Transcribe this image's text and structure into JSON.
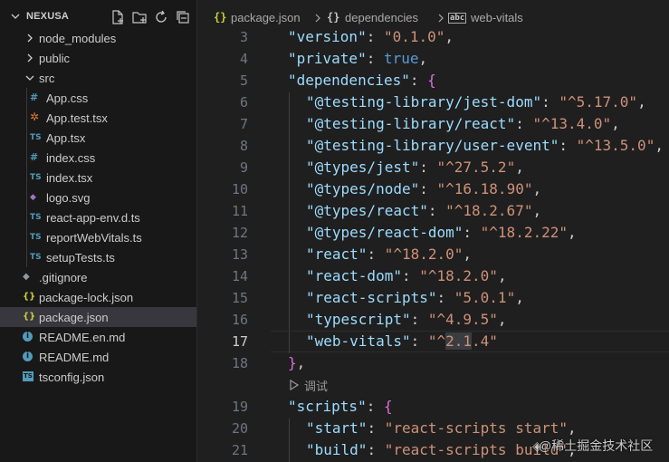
{
  "explorer": {
    "root_name": "NEXUSA",
    "actions": [
      {
        "name": "new-file-icon"
      },
      {
        "name": "new-folder-icon"
      },
      {
        "name": "refresh-icon"
      },
      {
        "name": "collapse-all-icon"
      }
    ]
  },
  "tree": [
    {
      "label": "node_modules",
      "type": "folder",
      "state": "collapsed",
      "depth": 1
    },
    {
      "label": "public",
      "type": "folder",
      "state": "collapsed",
      "depth": 1
    },
    {
      "label": "src",
      "type": "folder",
      "state": "expanded",
      "depth": 1
    },
    {
      "label": "App.css",
      "type": "file",
      "icon": "css",
      "glyph": "#",
      "color": "#519aba",
      "depth": 2
    },
    {
      "label": "App.test.tsx",
      "type": "file",
      "icon": "test",
      "glyph": "✲",
      "color": "#e37933",
      "depth": 2
    },
    {
      "label": "App.tsx",
      "type": "file",
      "icon": "ts",
      "glyph": "TS",
      "color": "#519aba",
      "depth": 2
    },
    {
      "label": "index.css",
      "type": "file",
      "icon": "css",
      "glyph": "#",
      "color": "#519aba",
      "depth": 2
    },
    {
      "label": "index.tsx",
      "type": "file",
      "icon": "ts",
      "glyph": "TS",
      "color": "#519aba",
      "depth": 2
    },
    {
      "label": "logo.svg",
      "type": "file",
      "icon": "svg",
      "glyph": "◆",
      "color": "#a074c4",
      "depth": 2
    },
    {
      "label": "react-app-env.d.ts",
      "type": "file",
      "icon": "ts",
      "glyph": "TS",
      "color": "#519aba",
      "depth": 2
    },
    {
      "label": "reportWebVitals.ts",
      "type": "file",
      "icon": "ts",
      "glyph": "TS",
      "color": "#519aba",
      "depth": 2
    },
    {
      "label": "setupTests.ts",
      "type": "file",
      "icon": "ts",
      "glyph": "TS",
      "color": "#519aba",
      "depth": 2
    },
    {
      "label": ".gitignore",
      "type": "file",
      "icon": "git",
      "glyph": "◆",
      "color": "#41535b",
      "depth": 1
    },
    {
      "label": "package-lock.json",
      "type": "file",
      "icon": "json",
      "glyph": "{}",
      "color": "#cbcb41",
      "depth": 1
    },
    {
      "label": "package.json",
      "type": "file",
      "icon": "json",
      "glyph": "{}",
      "color": "#cbcb41",
      "depth": 1,
      "selected": true
    },
    {
      "label": "README.en.md",
      "type": "file",
      "icon": "info",
      "glyph": "i",
      "color": "#519aba",
      "depth": 1
    },
    {
      "label": "README.md",
      "type": "file",
      "icon": "info",
      "glyph": "i",
      "color": "#519aba",
      "depth": 1
    },
    {
      "label": "tsconfig.json",
      "type": "file",
      "icon": "tsconfig",
      "glyph": "TS",
      "color": "#519aba",
      "depth": 1
    }
  ],
  "breadcrumb": {
    "file_glyph": "{}",
    "file": "package.json",
    "section_glyph": "{}",
    "section": "dependencies",
    "key_glyph": "abc",
    "key": "web-vitals"
  },
  "editor": {
    "current_line": "17",
    "codelens_label": "调试",
    "lines": [
      {
        "n": "3",
        "indent": 1,
        "tokens": [
          [
            "k",
            "\"version\""
          ],
          [
            "p",
            ": "
          ],
          [
            "s",
            "\"0.1.0\""
          ],
          [
            "p",
            ","
          ]
        ]
      },
      {
        "n": "4",
        "indent": 1,
        "tokens": [
          [
            "k",
            "\"private\""
          ],
          [
            "p",
            ": "
          ],
          [
            "b",
            "true"
          ],
          [
            "p",
            ","
          ]
        ]
      },
      {
        "n": "5",
        "indent": 1,
        "tokens": [
          [
            "k",
            "\"dependencies\""
          ],
          [
            "p",
            ": "
          ],
          [
            "br2",
            "{"
          ]
        ]
      },
      {
        "n": "6",
        "indent": 2,
        "tokens": [
          [
            "k",
            "\"@testing-library/jest-dom\""
          ],
          [
            "p",
            ": "
          ],
          [
            "s",
            "\"^5.17.0\""
          ],
          [
            "p",
            ","
          ]
        ]
      },
      {
        "n": "7",
        "indent": 2,
        "tokens": [
          [
            "k",
            "\"@testing-library/react\""
          ],
          [
            "p",
            ": "
          ],
          [
            "s",
            "\"^13.4.0\""
          ],
          [
            "p",
            ","
          ]
        ]
      },
      {
        "n": "8",
        "indent": 2,
        "tokens": [
          [
            "k",
            "\"@testing-library/user-event\""
          ],
          [
            "p",
            ": "
          ],
          [
            "s",
            "\"^13.5.0\""
          ],
          [
            "p",
            ","
          ]
        ]
      },
      {
        "n": "9",
        "indent": 2,
        "tokens": [
          [
            "k",
            "\"@types/jest\""
          ],
          [
            "p",
            ": "
          ],
          [
            "s",
            "\"^27.5.2\""
          ],
          [
            "p",
            ","
          ]
        ]
      },
      {
        "n": "10",
        "indent": 2,
        "tokens": [
          [
            "k",
            "\"@types/node\""
          ],
          [
            "p",
            ": "
          ],
          [
            "s",
            "\"^16.18.90\""
          ],
          [
            "p",
            ","
          ]
        ]
      },
      {
        "n": "11",
        "indent": 2,
        "tokens": [
          [
            "k",
            "\"@types/react\""
          ],
          [
            "p",
            ": "
          ],
          [
            "s",
            "\"^18.2.67\""
          ],
          [
            "p",
            ","
          ]
        ]
      },
      {
        "n": "12",
        "indent": 2,
        "tokens": [
          [
            "k",
            "\"@types/react-dom\""
          ],
          [
            "p",
            ": "
          ],
          [
            "s",
            "\"^18.2.22\""
          ],
          [
            "p",
            ","
          ]
        ]
      },
      {
        "n": "13",
        "indent": 2,
        "tokens": [
          [
            "k",
            "\"react\""
          ],
          [
            "p",
            ": "
          ],
          [
            "s",
            "\"^18.2.0\""
          ],
          [
            "p",
            ","
          ]
        ]
      },
      {
        "n": "14",
        "indent": 2,
        "tokens": [
          [
            "k",
            "\"react-dom\""
          ],
          [
            "p",
            ": "
          ],
          [
            "s",
            "\"^18.2.0\""
          ],
          [
            "p",
            ","
          ]
        ]
      },
      {
        "n": "15",
        "indent": 2,
        "tokens": [
          [
            "k",
            "\"react-scripts\""
          ],
          [
            "p",
            ": "
          ],
          [
            "s",
            "\"5.0.1\""
          ],
          [
            "p",
            ","
          ]
        ]
      },
      {
        "n": "16",
        "indent": 2,
        "tokens": [
          [
            "k",
            "\"typescript\""
          ],
          [
            "p",
            ": "
          ],
          [
            "s",
            "\"^4.9.5\""
          ],
          [
            "p",
            ","
          ]
        ]
      },
      {
        "n": "17",
        "indent": 2,
        "tokens": [
          [
            "k",
            "\"web-vitals\""
          ],
          [
            "p",
            ": "
          ],
          [
            "s",
            "\"^"
          ],
          [
            "s hl",
            "2.1"
          ],
          [
            "s",
            ".4\""
          ]
        ]
      },
      {
        "n": "18",
        "indent": 1,
        "tokens": [
          [
            "br2",
            "}"
          ],
          [
            "p",
            ","
          ]
        ]
      },
      {
        "n": "19",
        "indent": 1,
        "tokens": [
          [
            "k",
            "\"scripts\""
          ],
          [
            "p",
            ": "
          ],
          [
            "br2",
            "{"
          ]
        ]
      },
      {
        "n": "20",
        "indent": 2,
        "tokens": [
          [
            "k",
            "\"start\""
          ],
          [
            "p",
            ": "
          ],
          [
            "s",
            "\"react-scripts start\""
          ],
          [
            "p",
            ","
          ]
        ]
      },
      {
        "n": "21",
        "indent": 2,
        "tokens": [
          [
            "k",
            "\"build\""
          ],
          [
            "p",
            ": "
          ],
          [
            "s",
            "\"react-scripts build\""
          ],
          [
            "p",
            ","
          ]
        ]
      }
    ]
  },
  "watermark": "@稀土掘金技术社区"
}
